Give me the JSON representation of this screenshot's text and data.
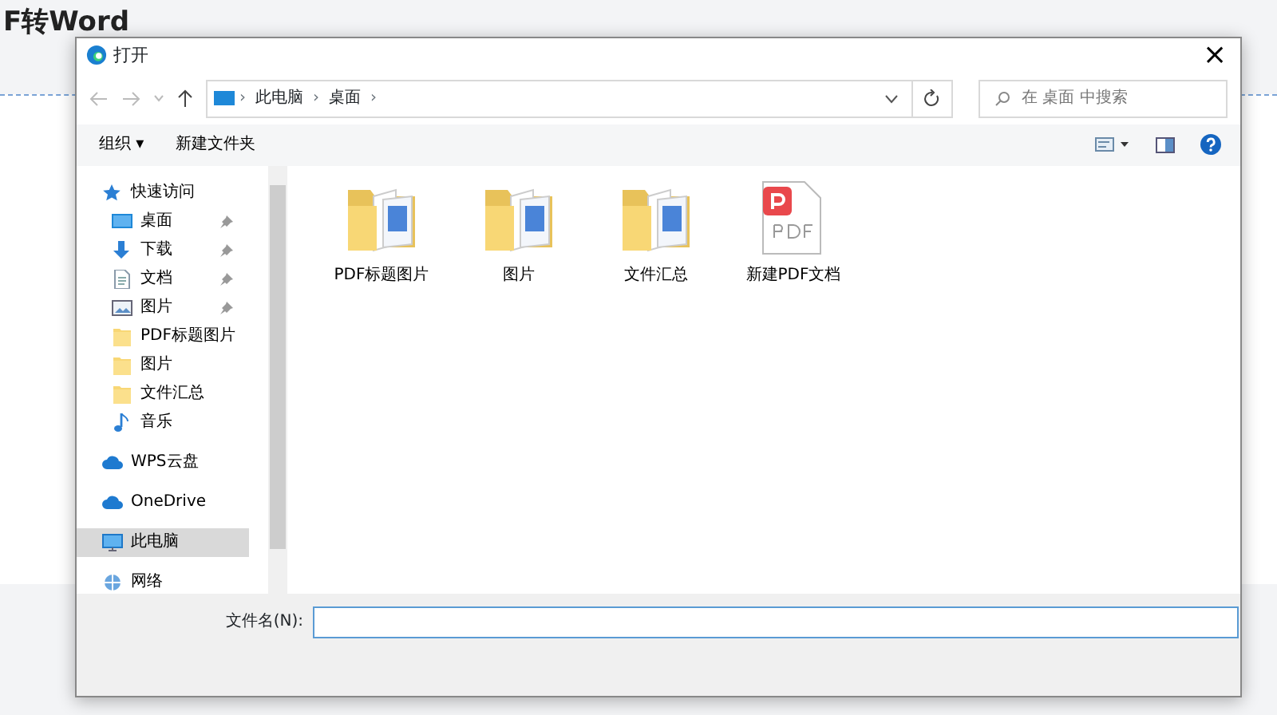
{
  "page": {
    "heading": "F转Word"
  },
  "dialog": {
    "title": "打开",
    "close": "×",
    "address": {
      "crumbs": [
        "此电脑",
        "桌面"
      ],
      "separator": "›"
    },
    "search": {
      "placeholder": "在 桌面 中搜索"
    },
    "toolbar": {
      "organize": "组织 ▾",
      "new_folder": "新建文件夹"
    },
    "sidebar": [
      {
        "kind": "star",
        "label": "快速访问",
        "pinned": false,
        "selected": false
      },
      {
        "kind": "desktop",
        "label": "桌面",
        "pinned": true,
        "selected": false
      },
      {
        "kind": "download",
        "label": "下载",
        "pinned": true,
        "selected": false
      },
      {
        "kind": "document",
        "label": "文档",
        "pinned": true,
        "selected": false
      },
      {
        "kind": "picture",
        "label": "图片",
        "pinned": true,
        "selected": false
      },
      {
        "kind": "folder",
        "label": "PDF标题图片",
        "pinned": false,
        "selected": false
      },
      {
        "kind": "folder",
        "label": "图片",
        "pinned": false,
        "selected": false
      },
      {
        "kind": "folder",
        "label": "文件汇总",
        "pinned": false,
        "selected": false
      },
      {
        "kind": "music",
        "label": "音乐",
        "pinned": false,
        "selected": false
      },
      {
        "kind": "cloud",
        "label": "WPS云盘",
        "pinned": false,
        "selected": false
      },
      {
        "kind": "cloud",
        "label": "OneDrive",
        "pinned": false,
        "selected": false
      },
      {
        "kind": "computer",
        "label": "此电脑",
        "pinned": false,
        "selected": true
      },
      {
        "kind": "network",
        "label": "网络",
        "pinned": false,
        "selected": false
      }
    ],
    "files": [
      {
        "kind": "folder",
        "name": "PDF标题图片"
      },
      {
        "kind": "folder",
        "name": "图片"
      },
      {
        "kind": "folder",
        "name": "文件汇总"
      },
      {
        "kind": "pdf",
        "name": "新建PDF文档"
      }
    ],
    "filename": {
      "label": "文件名(N):"
    }
  }
}
